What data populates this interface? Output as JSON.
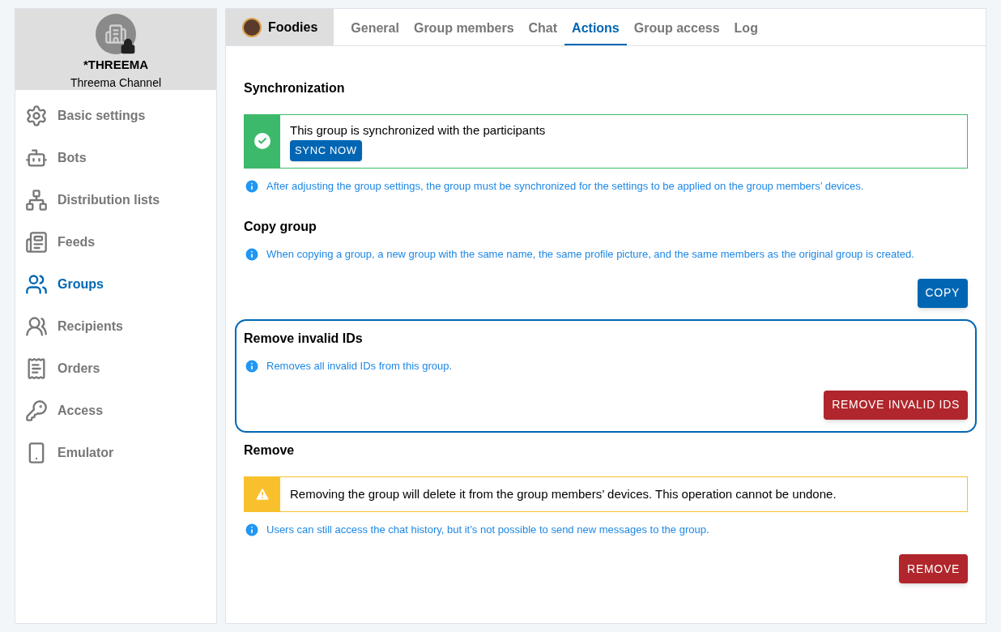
{
  "account": {
    "name": "*THREEMA",
    "subtitle": "Threema Channel"
  },
  "sidebar": {
    "items": [
      {
        "label": "Basic settings",
        "selected": false
      },
      {
        "label": "Bots",
        "selected": false
      },
      {
        "label": "Distribution lists",
        "selected": false
      },
      {
        "label": "Feeds",
        "selected": false
      },
      {
        "label": "Groups",
        "selected": true
      },
      {
        "label": "Recipients",
        "selected": false
      },
      {
        "label": "Orders",
        "selected": false
      },
      {
        "label": "Access",
        "selected": false
      },
      {
        "label": "Emulator",
        "selected": false
      }
    ]
  },
  "group": {
    "name": "Foodies"
  },
  "tabs": [
    {
      "label": "General",
      "selected": false
    },
    {
      "label": "Group members",
      "selected": false
    },
    {
      "label": "Chat",
      "selected": false
    },
    {
      "label": "Actions",
      "selected": true
    },
    {
      "label": "Group access",
      "selected": false
    },
    {
      "label": "Log",
      "selected": false
    }
  ],
  "sections": [
    {
      "title": "Synchronization",
      "highlighted": false,
      "alert": {
        "kind": "success",
        "text": "This group is synchronized with the participants",
        "button": "SYNC NOW"
      },
      "info": "After adjusting the group settings, the group must be synchronized for the settings to be applied on the group members’ devices."
    },
    {
      "title": "Copy group",
      "highlighted": false,
      "info": "When copying a group, a new group with the same name, the same profile picture, and the same members as the original group is created.",
      "button": {
        "label": "COPY",
        "kind": "primary"
      }
    },
    {
      "title": "Remove invalid IDs",
      "highlighted": true,
      "info": "Removes all invalid IDs from this group.",
      "button": {
        "label": "REMOVE INVALID IDS",
        "kind": "danger"
      }
    },
    {
      "title": "Remove",
      "highlighted": false,
      "alert": {
        "kind": "warning",
        "text": "Removing the group will delete it from the group members’ devices. This operation cannot be undone."
      },
      "info": "Users can still access the chat history, but it’s not possible to send new messages to the group.",
      "button": {
        "label": "REMOVE",
        "kind": "danger"
      }
    }
  ]
}
